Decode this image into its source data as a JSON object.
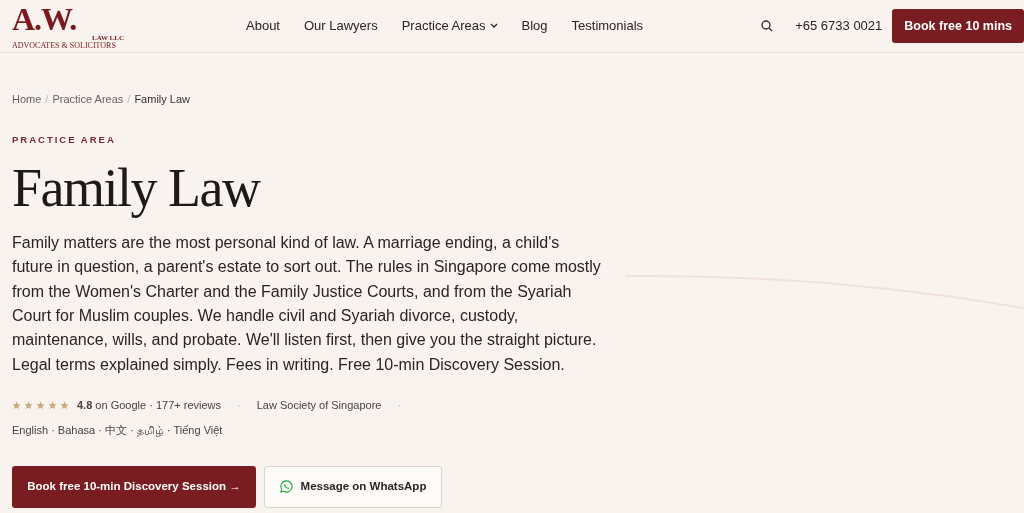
{
  "logo": {
    "mark": "A.W.",
    "sub": "LAW LLC",
    "tagline": "ADVOCATES & SOLICITORS"
  },
  "nav": [
    {
      "label": "About",
      "dropdown": false
    },
    {
      "label": "Our Lawyers",
      "dropdown": false
    },
    {
      "label": "Practice Areas",
      "dropdown": true
    },
    {
      "label": "Blog",
      "dropdown": false
    },
    {
      "label": "Testimonials",
      "dropdown": false
    }
  ],
  "phone": "+65 6733 0021",
  "header_button": "Book free 10 mins",
  "breadcrumb_separator": "/",
  "meta_separator": "·",
  "breadcrumb": [
    {
      "label": "Home",
      "current": false
    },
    {
      "label": "Practice Areas",
      "current": false
    },
    {
      "label": "Family Law",
      "current": true
    }
  ],
  "eyebrow": "PRACTICE AREA",
  "title": "Family Law",
  "intro": "Family matters are the most personal kind of law. A marriage ending, a child's future in question, a parent's estate to sort out. The rules in Singapore come mostly from the Women's Charter and the Family Justice Courts, and from the Syariah Court for Muslim couples. We handle civil and Syariah divorce, custody, maintenance, wills, and probate. We'll listen first, then give you the straight picture. Legal terms explained simply. Fees in writing. Free 10-min Discovery Session.",
  "rating": {
    "stars": 5,
    "text": "**4.8** on Google · 177+ reviews"
  },
  "credential": "Law Society of Singapore",
  "languages": "English · Bahasa · 中文 · தமிழ் · Tiếng Việt",
  "actions": [
    {
      "kind": "primary",
      "label": "Book free 10-min Discovery Session",
      "arrow": "→"
    },
    {
      "kind": "whatsapp",
      "label": "Message on WhatsApp"
    }
  ]
}
